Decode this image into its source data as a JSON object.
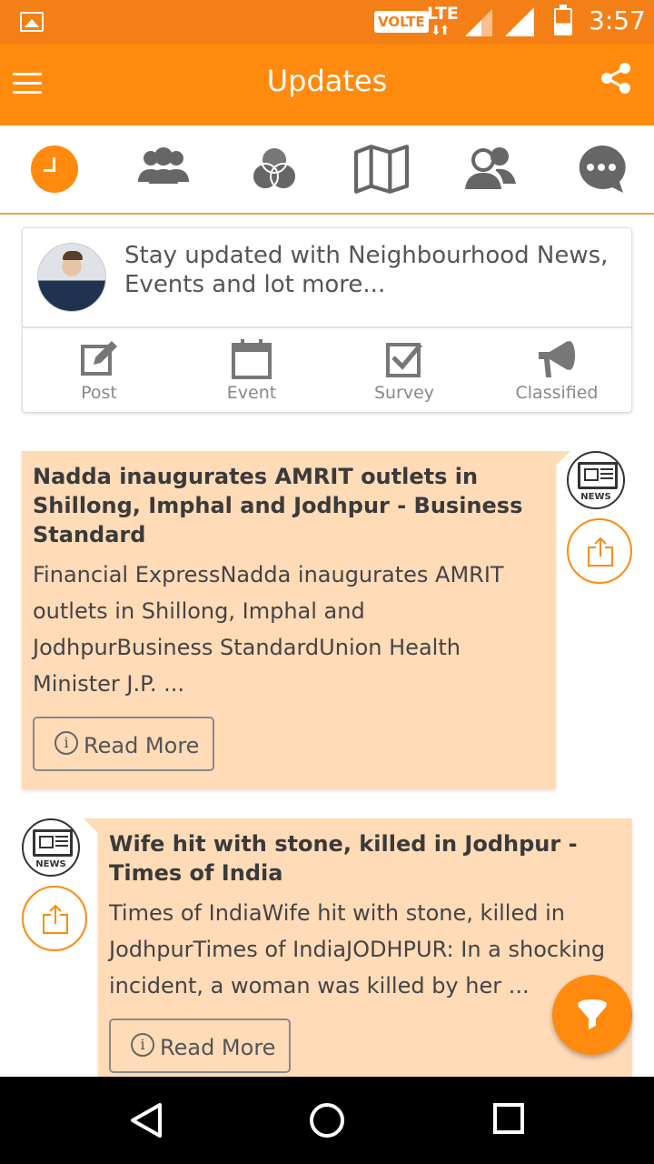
{
  "status_bar": {
    "network_badge": "VOLTE",
    "network_type": "LTE",
    "time": "3:57",
    "icons": [
      "image-notification-icon",
      "signal-icon",
      "signal-icon",
      "battery-icon"
    ]
  },
  "app_bar": {
    "title": "Updates",
    "menu_icon": "hamburger-menu-icon",
    "share_icon": "share-icon",
    "color": "#ff8a0d"
  },
  "tabs": [
    {
      "name": "updates",
      "icon": "clock-icon",
      "active": true
    },
    {
      "name": "members",
      "icon": "group-icon",
      "active": false
    },
    {
      "name": "groups",
      "icon": "venn-icon",
      "active": false
    },
    {
      "name": "map",
      "icon": "map-icon",
      "active": false
    },
    {
      "name": "contacts",
      "icon": "people-icon",
      "active": false
    },
    {
      "name": "chat",
      "icon": "chat-bubble-icon",
      "active": false
    }
  ],
  "composer": {
    "prompt": "Stay updated with Neighbourhood News, Events and lot more...",
    "actions": [
      {
        "label": "Post",
        "icon": "edit-icon"
      },
      {
        "label": "Event",
        "icon": "calendar-icon"
      },
      {
        "label": "Survey",
        "icon": "checkbox-icon"
      },
      {
        "label": "Classified",
        "icon": "megaphone-icon"
      }
    ]
  },
  "feed": [
    {
      "title": "Nadda inaugurates AMRIT outlets in Shillong, Imphal and Jodhpur - Business Standard",
      "body": "Financial ExpressNadda inaugurates AMRIT outlets in Shillong, Imphal and JodhpurBusiness StandardUnion Health Minister J.P. ...",
      "read_more": "Read More",
      "badge": "NEWS"
    },
    {
      "title": "Wife hit with stone, killed in Jodhpur - Times of India",
      "body": "Times of IndiaWife hit with stone, killed in JodhpurTimes of IndiaJODHPUR: In a shocking incident, a woman was killed by her ...",
      "read_more": "Read More",
      "badge": "NEWS"
    }
  ],
  "fab": {
    "icon": "filter-icon"
  },
  "colors": {
    "accent": "#ff8a0d",
    "status_bar": "#f57f17",
    "card_background": "#ffdbb8"
  },
  "info_glyph": "i",
  "nav": [
    "back-icon",
    "home-icon",
    "recents-icon"
  ]
}
